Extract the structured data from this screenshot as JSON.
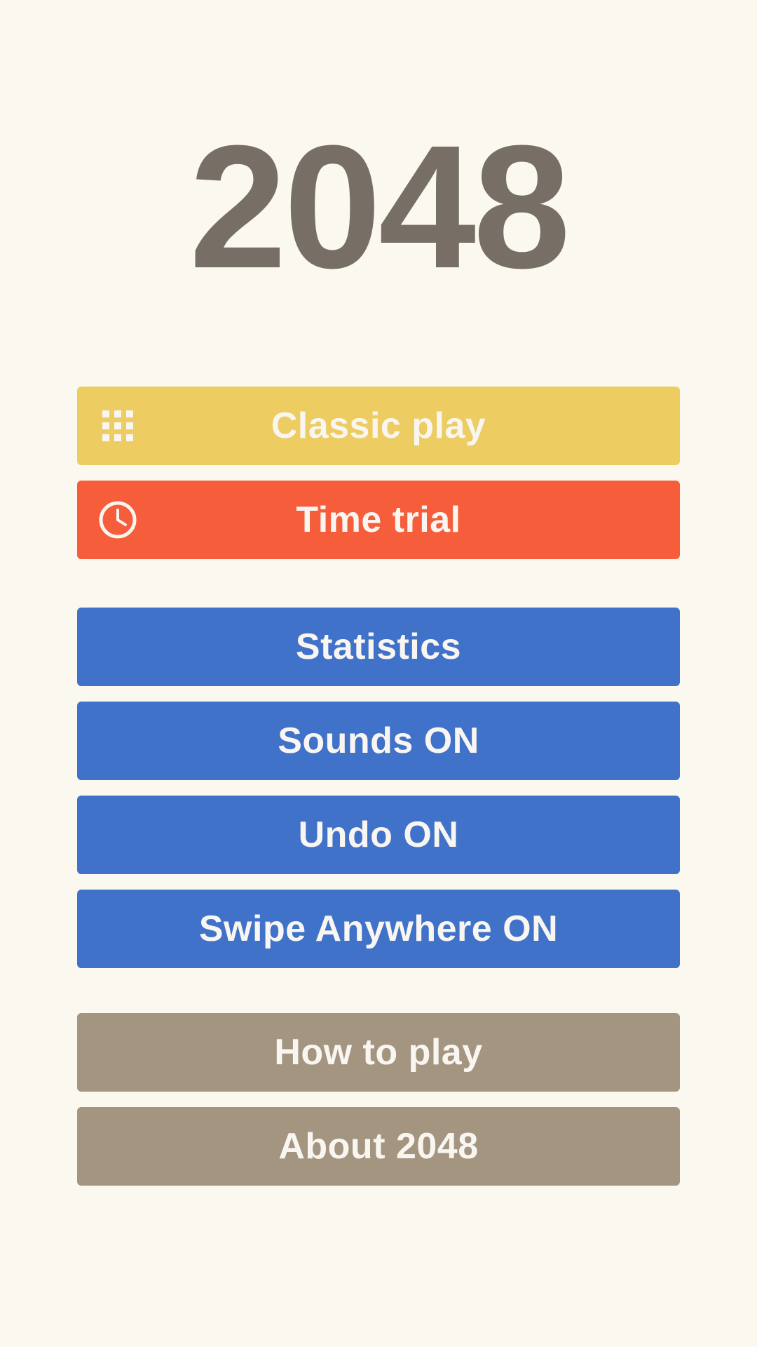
{
  "app": {
    "title": "2048"
  },
  "menu": {
    "game_modes": [
      {
        "label": "Classic play",
        "icon": "grid-icon",
        "color": "#EDCC61"
      },
      {
        "label": "Time trial",
        "icon": "clock-icon",
        "color": "#F65E3B"
      }
    ],
    "settings": [
      {
        "label": "Statistics",
        "color": "#4072C9"
      },
      {
        "label": "Sounds ON",
        "color": "#4072C9"
      },
      {
        "label": "Undo ON",
        "color": "#4072C9"
      },
      {
        "label": "Swipe Anywhere ON",
        "color": "#4072C9"
      }
    ],
    "info": [
      {
        "label": "How to play",
        "color": "#A49581"
      },
      {
        "label": "About 2048",
        "color": "#A49581"
      }
    ]
  },
  "colors": {
    "background": "#FBF8EF",
    "title_text": "#776E65",
    "button_text": "#F9F6F2"
  }
}
